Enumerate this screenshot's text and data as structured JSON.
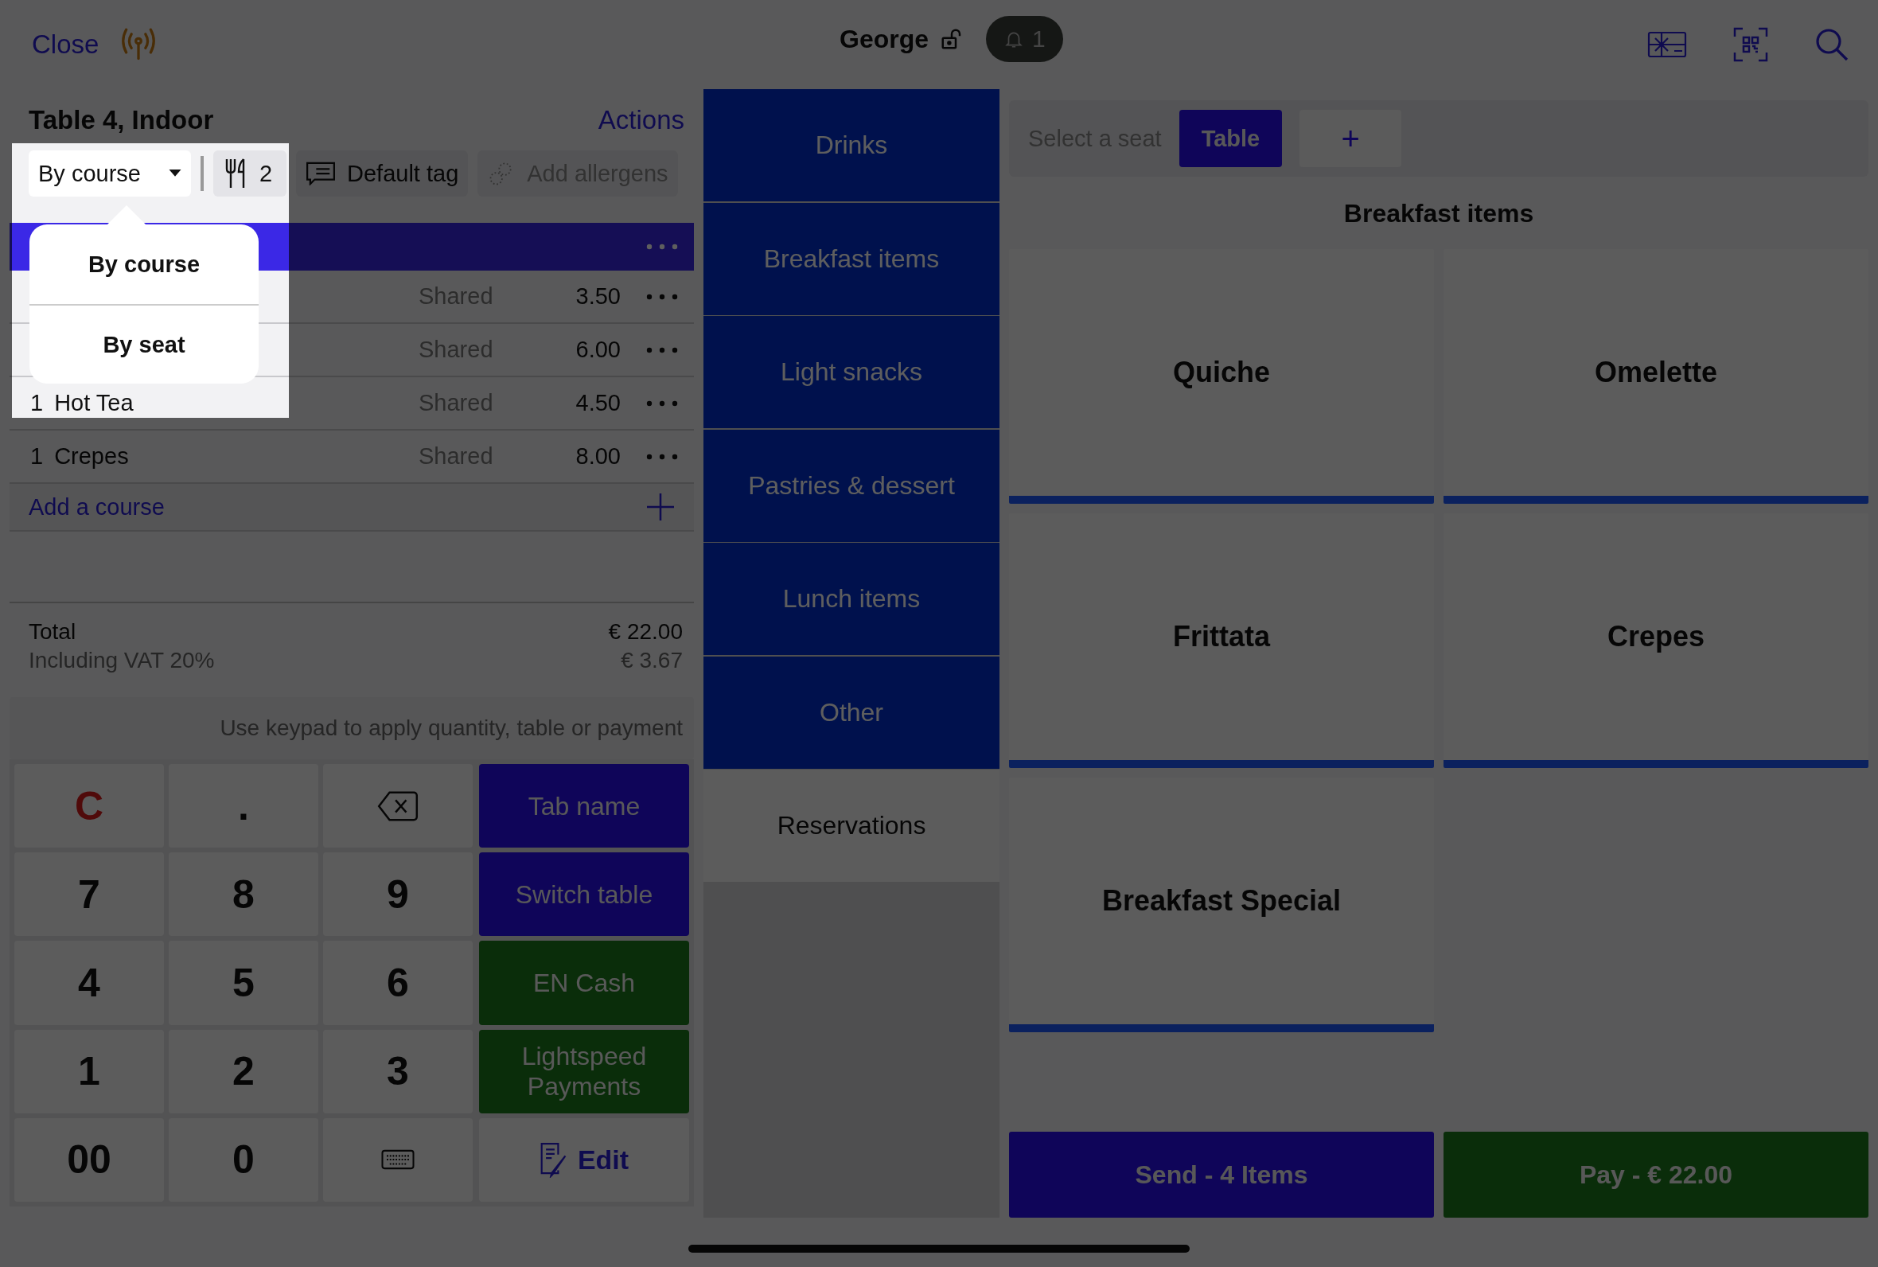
{
  "top_bar": {
    "close": "Close",
    "user": "George",
    "notifications": "1"
  },
  "order": {
    "title": "Table 4, Indoor",
    "actions": "Actions",
    "toolbar": {
      "view": "By course",
      "guests": "2",
      "tag": "Default tag",
      "allergens": {
        "label": "Add allergens",
        "disabled": true
      }
    },
    "view_menu": [
      "By course",
      "By seat"
    ],
    "rows": [
      {
        "qty": "",
        "name": "",
        "seat": "Shared",
        "price": "3.50"
      },
      {
        "qty": "",
        "name": "",
        "seat": "Shared",
        "price": "6.00"
      },
      {
        "qty": "1",
        "name": "Hot Tea",
        "seat": "Shared",
        "price": "4.50"
      },
      {
        "qty": "1",
        "name": "Crepes",
        "seat": "Shared",
        "price": "8.00"
      }
    ],
    "add_course": "Add a course",
    "total": {
      "label": "Total",
      "amount": "€ 22.00",
      "vat_label": "Including VAT 20%",
      "vat_amount": "€ 3.67"
    },
    "hint": "Use keypad to apply quantity, table or payment"
  },
  "keypad": {
    "keys": [
      {
        "kind": "clear",
        "label": "C"
      },
      {
        "kind": "digit",
        "label": "."
      },
      {
        "kind": "backspace"
      },
      {
        "kind": "digit",
        "label": "7"
      },
      {
        "kind": "digit",
        "label": "8"
      },
      {
        "kind": "digit",
        "label": "9"
      },
      {
        "kind": "digit",
        "label": "4"
      },
      {
        "kind": "digit",
        "label": "5"
      },
      {
        "kind": "digit",
        "label": "6"
      },
      {
        "kind": "digit",
        "label": "1"
      },
      {
        "kind": "digit",
        "label": "2"
      },
      {
        "kind": "digit",
        "label": "3"
      },
      {
        "kind": "digit",
        "label": "00"
      },
      {
        "kind": "digit",
        "label": "0"
      },
      {
        "kind": "keyboard"
      }
    ],
    "actions": [
      {
        "kind": "blue",
        "label": "Tab name"
      },
      {
        "kind": "blue",
        "label": "Switch table"
      },
      {
        "kind": "green",
        "label": "EN Cash"
      },
      {
        "kind": "green",
        "label": "Lightspeed Payments"
      },
      {
        "kind": "edit",
        "label": "Edit"
      }
    ]
  },
  "categories": [
    {
      "kind": "category",
      "label": "Drinks"
    },
    {
      "kind": "category",
      "label": "Breakfast items"
    },
    {
      "kind": "category",
      "label": "Light snacks"
    },
    {
      "kind": "category",
      "label": "Pastries & dessert"
    },
    {
      "kind": "category",
      "label": "Lunch items"
    },
    {
      "kind": "category",
      "label": "Other"
    },
    {
      "kind": "section",
      "label": "Reservations"
    }
  ],
  "seats": {
    "label": "Select a seat",
    "items": [
      {
        "label": "Table",
        "selected": true
      }
    ],
    "add": "+"
  },
  "products": {
    "title": "Breakfast items",
    "items": [
      "Quiche",
      "Omelette",
      "Frittata",
      "Crepes",
      "Breakfast Special"
    ]
  },
  "footer": {
    "send": "Send - 4 Items",
    "pay": "Pay - € 22.00"
  }
}
